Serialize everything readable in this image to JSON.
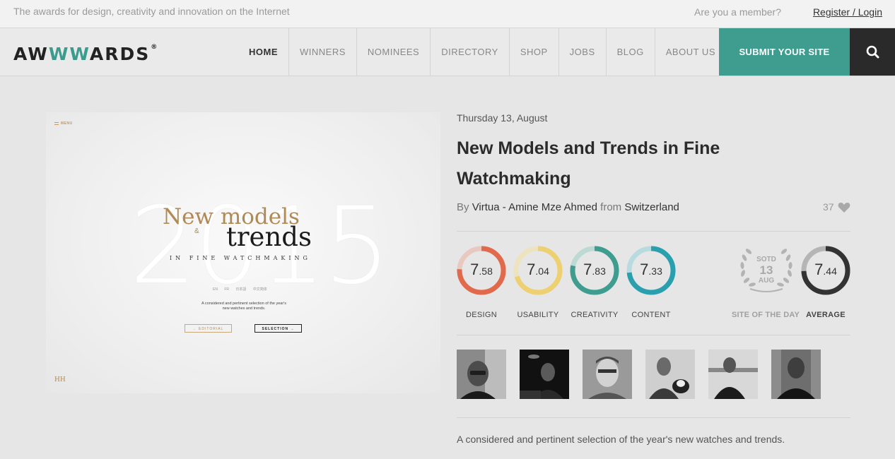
{
  "topbar": {
    "tagline": "The awards for design, creativity and innovation on the Internet",
    "member_question": "Are you a member?",
    "register_login": "Register / Login"
  },
  "nav": {
    "logo": {
      "prefix": "AW",
      "highlight": "WW",
      "suffix": "ARDS",
      "mark": "®"
    },
    "items": [
      "HOME",
      "WINNERS",
      "NOMINEES",
      "DIRECTORY",
      "SHOP",
      "JOBS",
      "BLOG",
      "ABOUT US"
    ],
    "submit_label": "SUBMIT YOUR SITE",
    "search_icon": "search-icon"
  },
  "preview": {
    "menu": "MENU",
    "year": "2015",
    "headline_1": "New models",
    "amp": "&",
    "headline_2": "trends",
    "subheadline": "IN FINE WATCHMAKING",
    "languages": "EN FR 日本語 中文简体",
    "description": "A considered and pertinent selection of the year's new watches and trends.",
    "button_editorial": "← EDITORIAL",
    "button_selection": "SELECTION →",
    "brand_mark": "HH"
  },
  "site": {
    "date": "Thursday 13, August",
    "title": "New Models and Trends in Fine Watchmaking",
    "by_label": "By",
    "author": "Virtua - Amine Mze Ahmed",
    "from_label": "from",
    "country": "Switzerland",
    "likes": "37",
    "description": "A considered and pertinent selection of the year's new watches and trends."
  },
  "scores": [
    {
      "label": "DESIGN",
      "int": "7",
      "dec": ".58",
      "value": 7.58,
      "color": "#e06a4b",
      "track": "#e9c9bf"
    },
    {
      "label": "USABILITY",
      "int": "7",
      "dec": ".04",
      "value": 7.04,
      "color": "#ecd071",
      "track": "#ede3bf"
    },
    {
      "label": "CREATIVITY",
      "int": "7",
      "dec": ".83",
      "value": 7.83,
      "color": "#3e9d8f",
      "track": "#bcd9d4"
    },
    {
      "label": "CONTENT",
      "int": "7",
      "dec": ".33",
      "value": 7.33,
      "color": "#2a9fae",
      "track": "#b8dbe0"
    }
  ],
  "sotd": {
    "badge_top": "SOTD",
    "day": "13",
    "month": "AUG",
    "label": "SITE OF THE DAY"
  },
  "average": {
    "label": "AVERAGE",
    "int": "7",
    "dec": ".44",
    "value": 7.44,
    "color": "#333333",
    "track": "#b5b5b5"
  },
  "jury_avatars": [
    "jury-member-1",
    "jury-member-2",
    "jury-member-3",
    "jury-member-4",
    "jury-member-5",
    "jury-member-6"
  ]
}
